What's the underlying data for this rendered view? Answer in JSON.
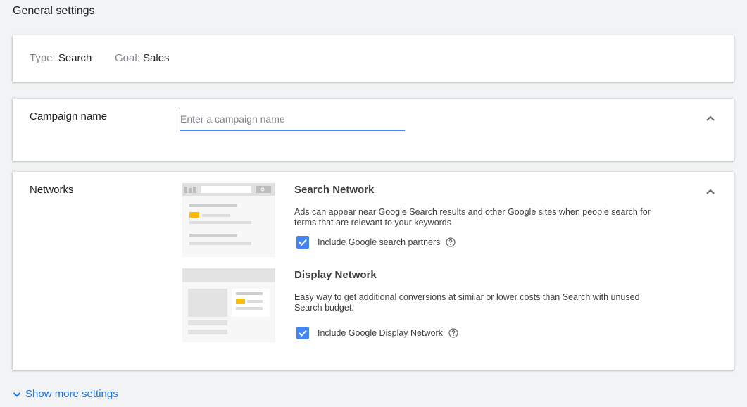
{
  "page": {
    "title": "General settings"
  },
  "type_card": {
    "type_key": "Type:",
    "type_value": "Search",
    "goal_key": "Goal:",
    "goal_value": "Sales"
  },
  "campaign_name": {
    "label": "Campaign name",
    "value": "",
    "placeholder": "Enter a campaign name"
  },
  "networks": {
    "label": "Networks",
    "search": {
      "title": "Search Network",
      "description": "Ads can appear near Google Search results and other Google sites when people search for terms that are relevant to your keywords",
      "checkbox_label": "Include Google search partners",
      "checked": true
    },
    "display": {
      "title": "Display Network",
      "description": "Easy way to get additional conversions at similar or lower costs than Search with unused Search budget.",
      "checkbox_label": "Include Google Display Network",
      "checked": true
    }
  },
  "footer": {
    "show_more_label": "Show more settings"
  },
  "colors": {
    "accent": "#4285f4",
    "link": "#1a73e8",
    "background": "#f1f3f4"
  },
  "icons": [
    "chevron-up-icon",
    "help-circle-icon",
    "check-icon",
    "chevron-down-icon"
  ]
}
